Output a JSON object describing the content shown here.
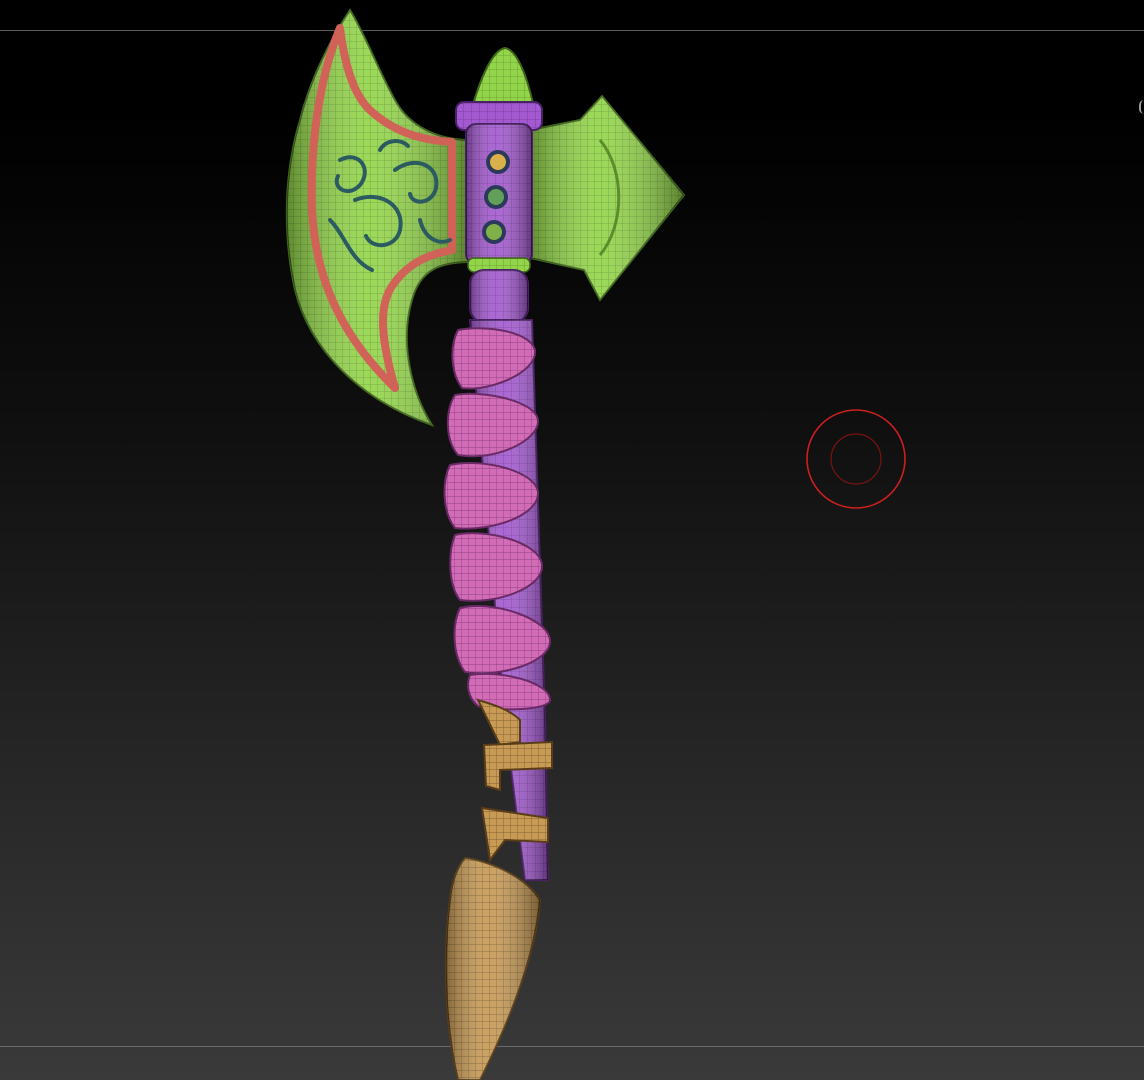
{
  "app": {
    "view": "3d-sculpt-viewport",
    "document": "polygroup-mesh-display"
  },
  "model": {
    "name": "stylized-battle-axe",
    "display_mode": "polyframe",
    "colors": {
      "blade": "#93d54a",
      "blade_dark": "#4f7d1f",
      "blade_rim": "#d06258",
      "filigree": "#2b5a61",
      "haft": "#a35ad0",
      "haft_dark": "#5e2a7e",
      "wrap": "#d26cb6",
      "wrap_dark": "#7c3277",
      "pommel_binding": "#c79a55",
      "pommel_dark": "#6f4f25",
      "gem_yellow": "#d9b04a",
      "gem_green": "#62a05a"
    }
  },
  "brush_cursor": {
    "color": "#cc1f1f"
  },
  "background": {
    "top": "#000000",
    "bottom": "#3a3a3a"
  }
}
